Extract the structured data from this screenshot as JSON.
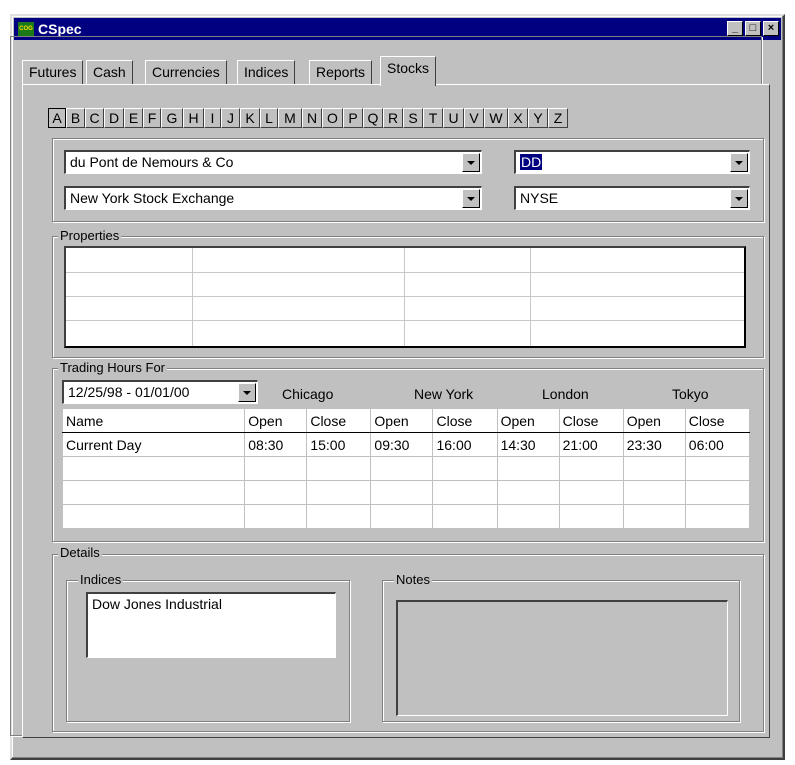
{
  "window": {
    "title": "CSpec",
    "app_icon_text": "COG",
    "minimize_glyph": "_",
    "maximize_glyph": "□",
    "close_glyph": "×"
  },
  "tabs": [
    "Futures",
    "Cash",
    "Currencies",
    "Indices",
    "Reports",
    "Stocks"
  ],
  "active_tab": "Stocks",
  "letters": [
    "A",
    "B",
    "C",
    "D",
    "E",
    "F",
    "G",
    "H",
    "I",
    "J",
    "K",
    "L",
    "M",
    "N",
    "O",
    "P",
    "Q",
    "R",
    "S",
    "T",
    "U",
    "V",
    "W",
    "X",
    "Y",
    "Z"
  ],
  "active_letter": "A",
  "selection": {
    "company": "du Pont de Nemours & Co",
    "symbol": "DD",
    "exchange": "New York Stock Exchange",
    "exchange_code": "NYSE"
  },
  "properties": {
    "label": "Properties"
  },
  "trading_hours": {
    "label": "Trading Hours For",
    "date_range": "12/25/98 - 01/01/00",
    "cities": [
      "Chicago",
      "New York",
      "London",
      "Tokyo"
    ],
    "columns": [
      "Name",
      "Open",
      "Close",
      "Open",
      "Close",
      "Open",
      "Close",
      "Open",
      "Close"
    ],
    "rows": [
      [
        "Current Day",
        "08:30",
        "15:00",
        "09:30",
        "16:00",
        "14:30",
        "21:00",
        "23:30",
        "06:00"
      ]
    ]
  },
  "details": {
    "label": "Details",
    "indices_label": "Indices",
    "indices": [
      "Dow Jones Industrial"
    ],
    "notes_label": "Notes"
  }
}
